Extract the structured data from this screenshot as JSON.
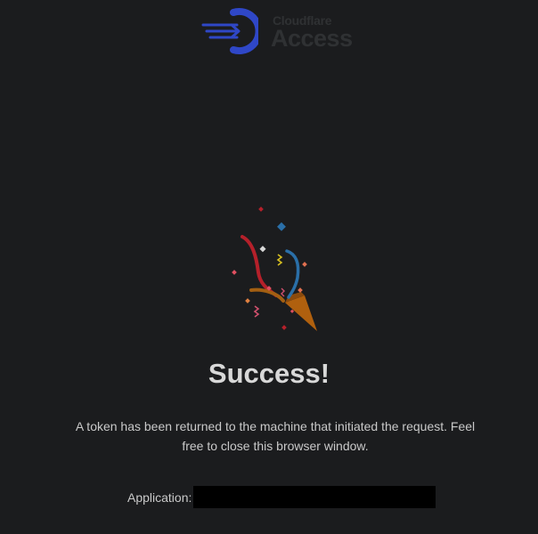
{
  "brand": {
    "name_small": "Cloudflare",
    "name_large": "Access",
    "icon": "cloudflare-access-logo-icon",
    "accent_color": "#2f47c7"
  },
  "illustration": {
    "icon": "party-popper-icon"
  },
  "main": {
    "title": "Success!",
    "message": "A token has been returned to the machine that initiated the request. Feel free to close this browser window."
  },
  "application": {
    "label": "Application:",
    "value_redacted": true
  }
}
